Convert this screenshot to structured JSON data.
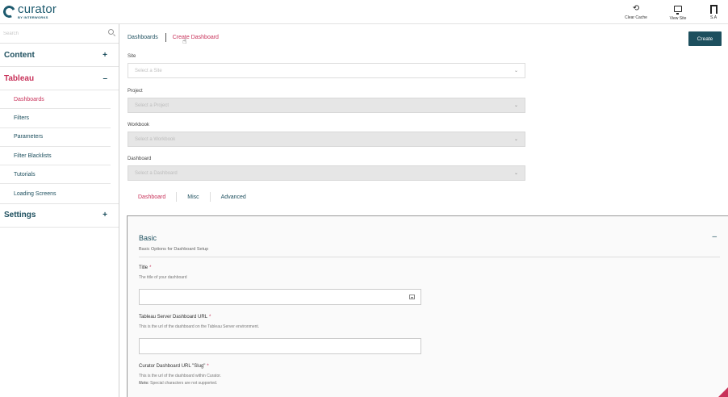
{
  "header": {
    "logo_name": "curator",
    "logo_sub": "BY INTERWORKS",
    "actions": [
      {
        "icon": "refresh-icon",
        "label": "Clear Cache"
      },
      {
        "icon": "monitor-icon",
        "label": "View Site"
      },
      {
        "icon": "user-icon",
        "label": "S.A"
      }
    ]
  },
  "sidebar": {
    "search_placeholder": "Search",
    "sections": [
      {
        "name": "Content",
        "toggle": "+"
      },
      {
        "name": "Tableau",
        "toggle": "–"
      },
      {
        "name": "Settings",
        "toggle": "+"
      }
    ],
    "tableau_items": [
      "Dashboards",
      "Filters",
      "Parameters",
      "Filter Blacklists",
      "Tutorials",
      "Loading Screens"
    ]
  },
  "breadcrumb": {
    "parent": "Dashboards",
    "current": "Create Dashboard"
  },
  "create_label": "Create",
  "form": {
    "site": {
      "label": "Site",
      "placeholder": "Select a Site"
    },
    "project": {
      "label": "Project",
      "placeholder": "Select a Project"
    },
    "workbook": {
      "label": "Workbook",
      "placeholder": "Select a Workbook"
    },
    "dashboard": {
      "label": "Dashboard",
      "placeholder": "Select a Dashboard"
    }
  },
  "tabs": [
    "Dashboard",
    "Misc",
    "Advanced"
  ],
  "panel": {
    "title": "Basic",
    "subtitle": "Basic Options for Dashboard Setup",
    "collapse": "–",
    "fields": [
      {
        "label": "Title",
        "help": "The title of your dashboard"
      },
      {
        "label": "Tableau Server Dashboard URL",
        "help": "This is the url of the dashboard on the Tableau Server environment."
      },
      {
        "label": "Curator Dashboard URL \"Slug\"",
        "help": "This is the url of the dashboard within Curator.",
        "note_label": "Note:",
        "note": "Special characters are not supported."
      }
    ]
  },
  "colors": {
    "accent": "#c8325a",
    "brand": "#1d4f5e"
  }
}
